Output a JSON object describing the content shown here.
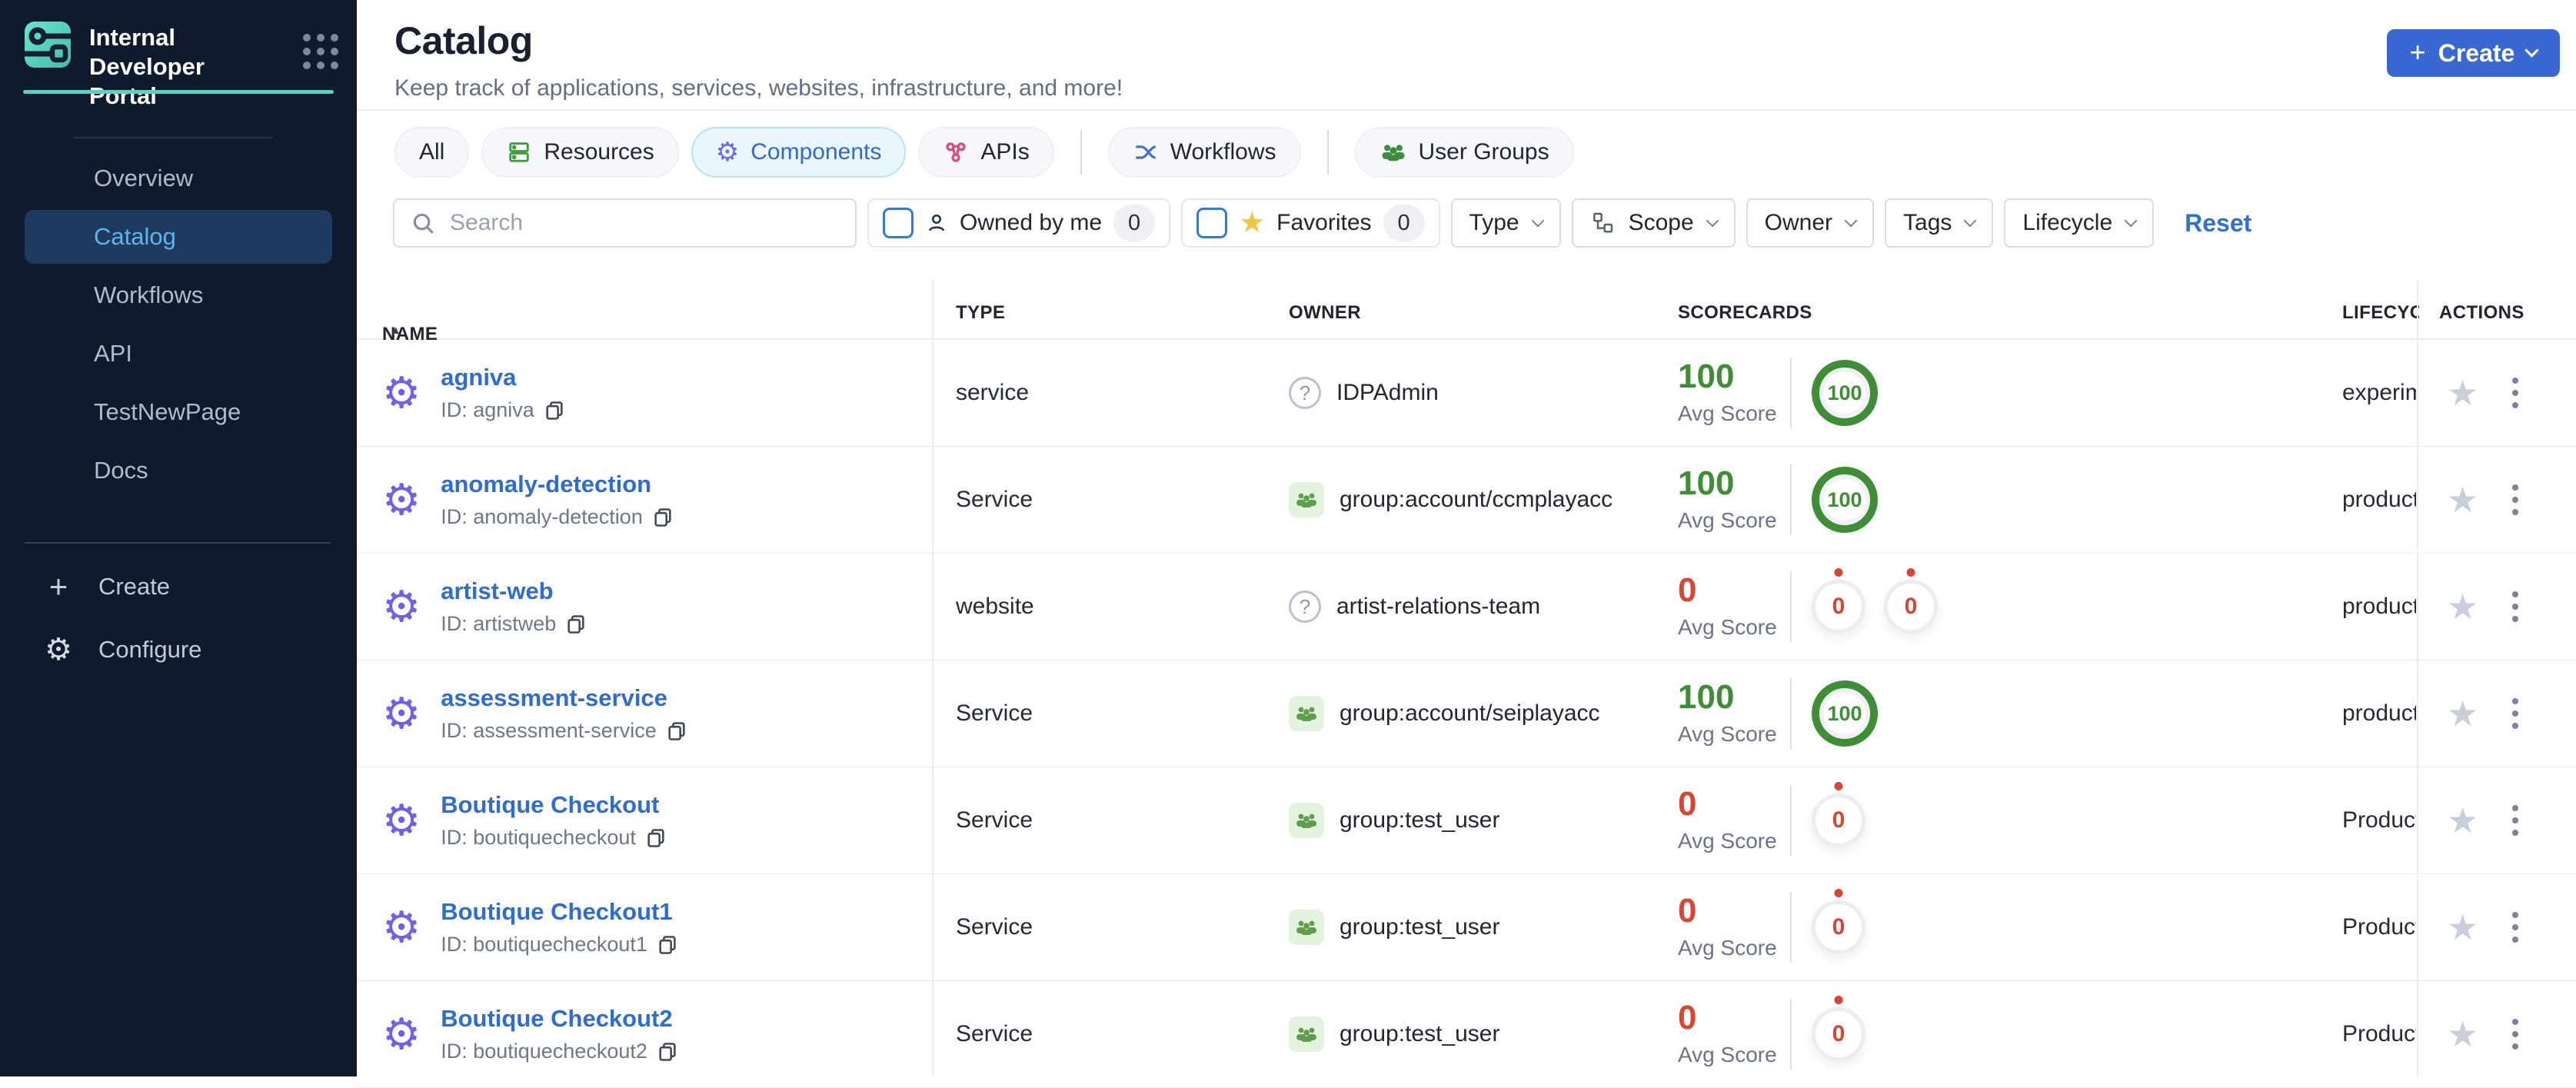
{
  "colors": {
    "sidebar_bg": "#0f1a2c",
    "sidebar_active_bg": "#1e3a5e",
    "sidebar_active_text": "#5cb6ea",
    "brand_teal": "#58d1be",
    "accent_blue": "#3a68d2",
    "link_blue": "#2e6cd5",
    "score_green": "#3e8e35",
    "score_red": "#d9452f",
    "tab_selected_bg": "#e9f7fd",
    "gear_purple": "#6e5ff0",
    "apis_pink": "#e14578",
    "resources_green": "#3f9d3f"
  },
  "sidebar": {
    "brand_title": "Internal Developer Portal",
    "items": [
      {
        "label": "Overview"
      },
      {
        "label": "Catalog",
        "active": true
      },
      {
        "label": "Workflows"
      },
      {
        "label": "API"
      },
      {
        "label": "TestNewPage"
      },
      {
        "label": "Docs"
      }
    ],
    "footer_items": [
      {
        "label": "Create"
      },
      {
        "label": "Configure"
      }
    ]
  },
  "header": {
    "title": "Catalog",
    "subtitle": "Keep track of applications, services, websites, infrastructure, and more!",
    "create_button": "Create"
  },
  "tabs": [
    {
      "label": "All"
    },
    {
      "label": "Resources"
    },
    {
      "label": "Components",
      "selected": true
    },
    {
      "label": "APIs"
    },
    {
      "label": "Workflows"
    },
    {
      "label": "User Groups"
    }
  ],
  "filters": {
    "search_placeholder": "Search",
    "owned_by_me": {
      "label": "Owned by me",
      "count": "0"
    },
    "favorites": {
      "label": "Favorites",
      "count": "0"
    },
    "dropdowns": [
      {
        "label": "Type"
      },
      {
        "label": "Scope"
      },
      {
        "label": "Owner"
      },
      {
        "label": "Tags"
      },
      {
        "label": "Lifecycle"
      }
    ],
    "reset_label": "Reset"
  },
  "table": {
    "columns": [
      "NAME",
      "TYPE",
      "OWNER",
      "SCORECARDS",
      "LIFECYCLE",
      "ACTIONS"
    ],
    "avg_score_label": "Avg Score",
    "rows": [
      {
        "name": "agniva",
        "id_label": "ID: agniva",
        "type": "service",
        "owner": {
          "kind": "user",
          "label": "IDPAdmin"
        },
        "score": {
          "value": "100",
          "variant": "high"
        },
        "rings": [
          {
            "value": "100",
            "variant": "high"
          }
        ],
        "lifecycle": "experimental"
      },
      {
        "name": "anomaly-detection",
        "id_label": "ID: anomaly-detection",
        "type": "Service",
        "owner": {
          "kind": "group",
          "label": "group:account/ccmplayacc"
        },
        "score": {
          "value": "100",
          "variant": "high"
        },
        "rings": [
          {
            "value": "100",
            "variant": "high"
          }
        ],
        "lifecycle": "production"
      },
      {
        "name": "artist-web",
        "id_label": "ID: artistweb",
        "type": "website",
        "owner": {
          "kind": "user",
          "label": "artist-relations-team"
        },
        "score": {
          "value": "0",
          "variant": "zero"
        },
        "rings": [
          {
            "value": "0",
            "variant": "zero"
          },
          {
            "value": "0",
            "variant": "zero"
          }
        ],
        "lifecycle": "production"
      },
      {
        "name": "assessment-service",
        "id_label": "ID: assessment-service",
        "type": "Service",
        "owner": {
          "kind": "group",
          "label": "group:account/seiplayacc"
        },
        "score": {
          "value": "100",
          "variant": "high"
        },
        "rings": [
          {
            "value": "100",
            "variant": "high"
          }
        ],
        "lifecycle": "production"
      },
      {
        "name": "Boutique Checkout",
        "id_label": "ID: boutiquecheckout",
        "type": "Service",
        "owner": {
          "kind": "group",
          "label": "group:test_user"
        },
        "score": {
          "value": "0",
          "variant": "zero"
        },
        "rings": [
          {
            "value": "0",
            "variant": "zero"
          }
        ],
        "lifecycle": "Production"
      },
      {
        "name": "Boutique Checkout1",
        "id_label": "ID: boutiquecheckout1",
        "type": "Service",
        "owner": {
          "kind": "group",
          "label": "group:test_user"
        },
        "score": {
          "value": "0",
          "variant": "zero"
        },
        "rings": [
          {
            "value": "0",
            "variant": "zero"
          }
        ],
        "lifecycle": "Production"
      },
      {
        "name": "Boutique Checkout2",
        "id_label": "ID: boutiquecheckout2",
        "type": "Service",
        "owner": {
          "kind": "group",
          "label": "group:test_user"
        },
        "score": {
          "value": "0",
          "variant": "zero"
        },
        "rings": [
          {
            "value": "0",
            "variant": "zero"
          }
        ],
        "lifecycle": "Production"
      }
    ]
  }
}
